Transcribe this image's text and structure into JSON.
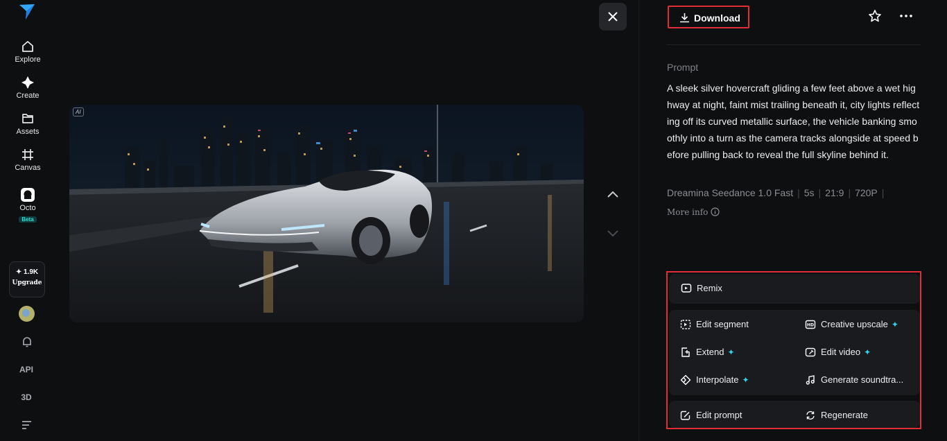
{
  "sidebar": {
    "logo_icon": "dreamina-logo-icon",
    "items": [
      {
        "label": "Explore",
        "icon": "home-icon"
      },
      {
        "label": "Create",
        "icon": "sparkle-icon"
      },
      {
        "label": "Assets",
        "icon": "folder-icon"
      },
      {
        "label": "Canvas",
        "icon": "canvas-icon"
      },
      {
        "label": "Octo",
        "icon": "octo-icon",
        "badge": "Beta"
      }
    ],
    "credits": "1.9K",
    "upgrade_label": "Upgrade",
    "api_label": "API",
    "three_d_label": "3D"
  },
  "media": {
    "ai_badge": "AI"
  },
  "panel": {
    "download_label": "Download",
    "prompt_heading": "Prompt",
    "prompt_text": "A sleek silver hovercraft gliding a few feet above a wet highway at night, faint mist trailing beneath it, city lights reflecting off its curved metallic surface, the vehicle banking smoothly into a turn as the camera tracks alongside at speed before pulling back to reveal the full skyline behind it.",
    "meta": {
      "model": "Dreamina Seedance 1.0 Fast",
      "duration": "5s",
      "ratio": "21:9",
      "resolution": "720P"
    },
    "more_info": "More info"
  },
  "actions": {
    "remix": "Remix",
    "edit_segment": "Edit segment",
    "creative_upscale": "Creative upscale",
    "extend": "Extend",
    "edit_video": "Edit video",
    "interpolate": "Interpolate",
    "generate_soundtrack": "Generate soundtra...",
    "edit_prompt": "Edit prompt",
    "regenerate": "Regenerate"
  },
  "colors": {
    "background": "#0e0f11",
    "card": "#1a1b1f",
    "highlight_border": "#e02d36",
    "accent_spark": "#2fd3e6",
    "beta_text": "#27e0d2"
  }
}
